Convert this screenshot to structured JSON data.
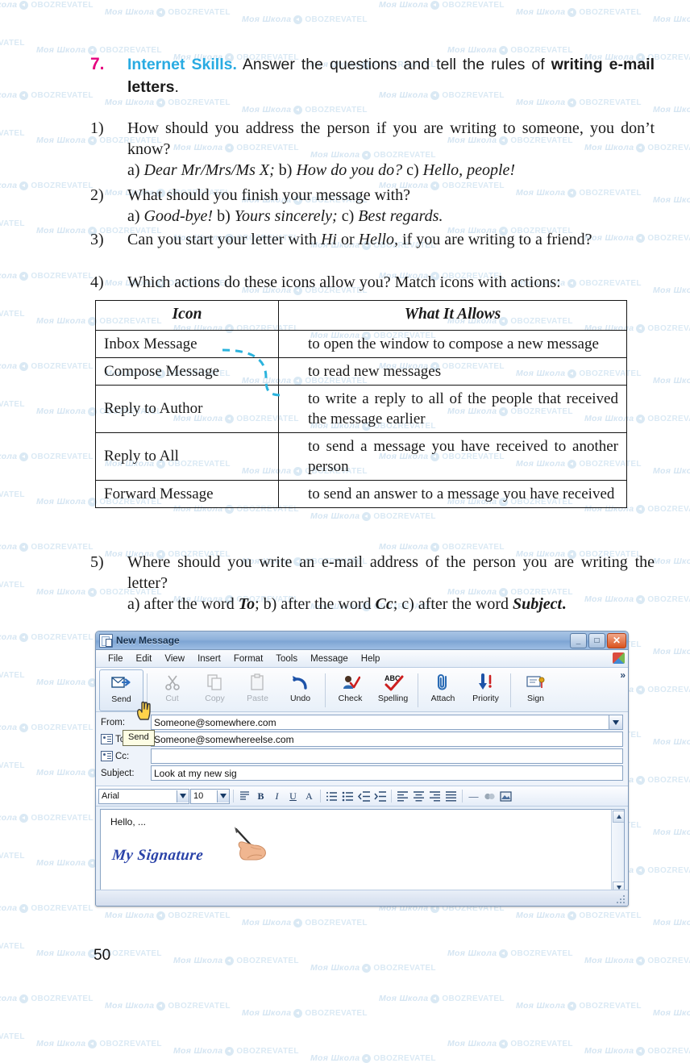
{
  "exercise": {
    "number": "7.",
    "title": "Internet Skills.",
    "instruction_part1": " Answer the questions and tell the rules of ",
    "instruction_bold": "writing e-mail letters",
    "instruction_end": "."
  },
  "questions": [
    {
      "num": "1)",
      "text": "How should you address the person if you are writing to someone, you don’t know?",
      "options_prefix_a": "a) ",
      "option_a": "Dear Mr/Mrs/Ms X;",
      "options_prefix_b": " b) ",
      "option_b": "How do you do?",
      "options_prefix_c": "  c) ",
      "option_c": "Hello, people!"
    },
    {
      "num": "2)",
      "text": "What should you finish your message with?",
      "options_prefix_a": "a) ",
      "option_a": "Good-bye!",
      "options_prefix_b": " b) ",
      "option_b": "Yours sincerely;",
      "options_prefix_c": "  c) ",
      "option_c": "Best regards."
    },
    {
      "num": "3)",
      "text_1": "Can you start your letter with ",
      "em_1": "Hi",
      "text_2": " or ",
      "em_2": "Hello",
      "text_3": ", if you are writing to a friend?"
    },
    {
      "num": "4)",
      "text": "Which actions do these icons allow you? Match icons with actions:"
    },
    {
      "num": "5)",
      "text": "Where should you write an e-mail address of the person you are writing the letter?",
      "options_prefix_a": "a) after the word ",
      "option_a": "To",
      "options_prefix_b": "; b) after the word ",
      "option_b": "Cc",
      "options_prefix_c": "; c) after the word ",
      "option_c": "Subject",
      "options_end": "."
    }
  ],
  "match_table": {
    "headers": [
      "Icon",
      "What It Allows"
    ],
    "rows": [
      {
        "icon": "Inbox Message",
        "allows": "to open the window to compose a new message"
      },
      {
        "icon": "Compose Message",
        "allows": "to read new messages"
      },
      {
        "icon": "Reply to Author",
        "allows": "to write a reply to all of the people that received the message earlier"
      },
      {
        "icon": "Reply to All",
        "allows": "to send a message you have received to another person"
      },
      {
        "icon": "Forward Message",
        "allows": "to send an answer to a message you have received"
      }
    ],
    "connector_color": "#2bb3dd",
    "connector_from_row": 0,
    "connector_to_row": 1
  },
  "email_window": {
    "title": "New Message",
    "window_buttons": {
      "minimize": "_",
      "maximize": "□",
      "close": "✕"
    },
    "menus": [
      "File",
      "Edit",
      "View",
      "Insert",
      "Format",
      "Tools",
      "Message",
      "Help"
    ],
    "toolbar": [
      {
        "label": "Send",
        "icon": "send-icon",
        "disabled": false
      },
      {
        "label": "Cut",
        "icon": "scissors-icon",
        "disabled": true
      },
      {
        "label": "Copy",
        "icon": "copy-icon",
        "disabled": true
      },
      {
        "label": "Paste",
        "icon": "paste-icon",
        "disabled": true
      },
      {
        "label": "Undo",
        "icon": "undo-icon",
        "disabled": false
      },
      {
        "label": "Check",
        "icon": "check-names-icon",
        "disabled": false
      },
      {
        "label": "Spelling",
        "icon": "spelling-abc-icon",
        "disabled": false
      },
      {
        "label": "Attach",
        "icon": "paperclip-icon",
        "disabled": false
      },
      {
        "label": "Priority",
        "icon": "priority-arrow-icon",
        "disabled": false
      },
      {
        "label": "Sign",
        "icon": "signature-icon",
        "disabled": false
      }
    ],
    "toolbar_overflow": "»",
    "tooltip": "Send",
    "fields": [
      {
        "label": "From:",
        "value": "Someone@somewhere.com",
        "has_dropdown": true,
        "has_book_icon": false,
        "placeholder": ""
      },
      {
        "label": "To:",
        "value": "Someone@somewhereelse.com",
        "has_dropdown": false,
        "has_book_icon": true,
        "placeholder": ""
      },
      {
        "label": "Cc:",
        "value": "",
        "has_dropdown": false,
        "has_book_icon": true,
        "placeholder": ""
      },
      {
        "label": "Subject:",
        "value": "Look at my new sig",
        "has_dropdown": false,
        "has_book_icon": false,
        "placeholder": ""
      }
    ],
    "format_bar": {
      "font_name": "Arial",
      "font_size": "10",
      "buttons": [
        {
          "name": "paragraph-style-icon",
          "glyph": "≡"
        },
        {
          "name": "bold-icon",
          "glyph": "B"
        },
        {
          "name": "italic-icon",
          "glyph": "I"
        },
        {
          "name": "underline-icon",
          "glyph": "U"
        },
        {
          "name": "font-color-icon",
          "glyph": "A"
        },
        {
          "name": "numbered-list-icon",
          "glyph": "≣"
        },
        {
          "name": "bullet-list-icon",
          "glyph": "≣"
        },
        {
          "name": "decrease-indent-icon",
          "glyph": "⇤"
        },
        {
          "name": "increase-indent-icon",
          "glyph": "⇥"
        },
        {
          "name": "align-left-icon",
          "glyph": "≡"
        },
        {
          "name": "align-center-icon",
          "glyph": "≡"
        },
        {
          "name": "align-right-icon",
          "glyph": "≡"
        },
        {
          "name": "justify-icon",
          "glyph": "≡"
        },
        {
          "name": "horizontal-rule-icon",
          "glyph": "—"
        },
        {
          "name": "insert-link-icon",
          "glyph": "⚭"
        },
        {
          "name": "insert-image-icon",
          "glyph": "▣"
        }
      ]
    },
    "body": {
      "greeting": "Hello, ...",
      "signature_text": "My Signature"
    }
  },
  "page_number": "50",
  "watermark": {
    "school": "Моя Школа",
    "site": "OBOZREVATEL",
    "color": "#bcd8ec"
  },
  "colors": {
    "exercise_number": "#e5007e",
    "exercise_title": "#29abe2",
    "connector": "#2bb3dd",
    "signature": "#2a42a8"
  }
}
